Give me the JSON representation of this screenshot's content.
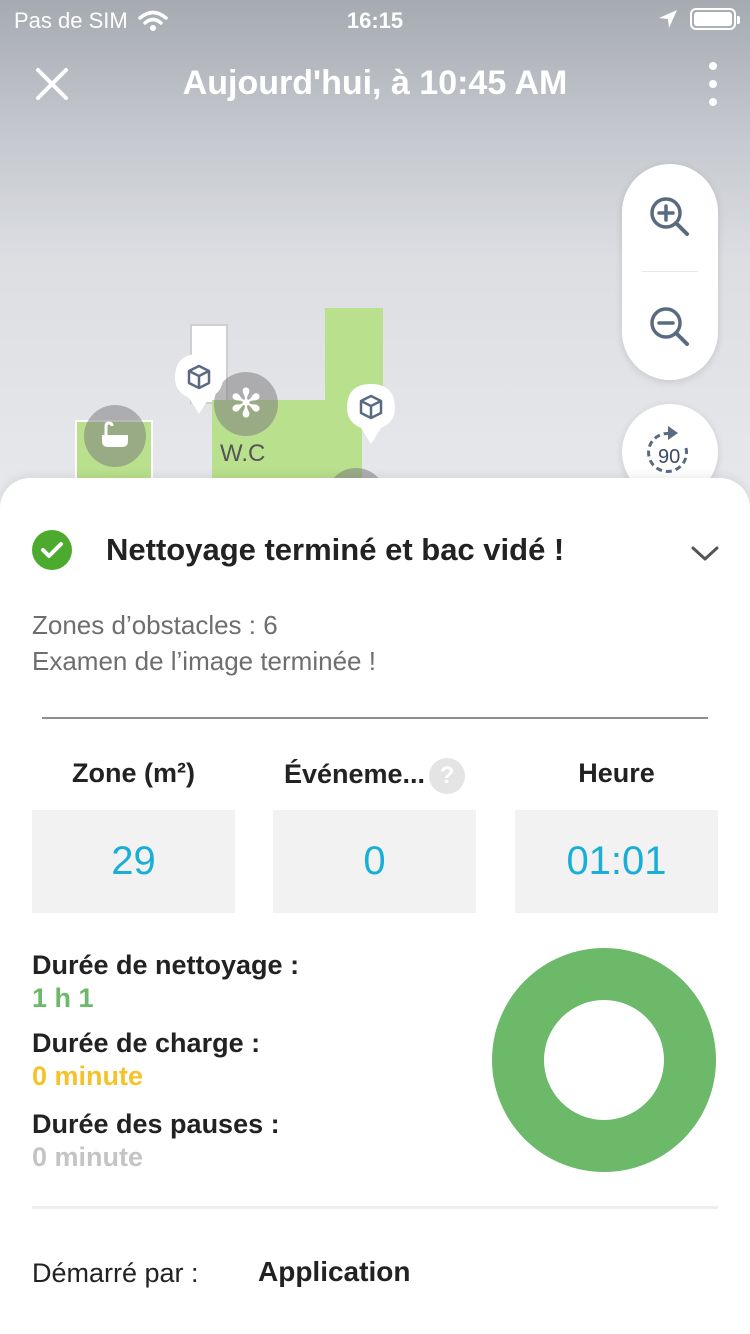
{
  "status_bar": {
    "carrier": "Pas de SIM",
    "time": "16:15"
  },
  "nav": {
    "title": "Aujourd'hui, à 10:45 AM"
  },
  "map": {
    "room_label": "W.C",
    "rotate_label": "90"
  },
  "summary": {
    "status_title": "Nettoyage terminé et bac vidé !",
    "obstacle_zones": "Zones d’obstacles : 6",
    "image_review": "Examen de l’image terminée !"
  },
  "stats": [
    {
      "label": "Zone (m²)",
      "value": "29"
    },
    {
      "label": "Événeme...",
      "value": "0"
    },
    {
      "label": "Heure",
      "value": "01:01"
    }
  ],
  "durations": {
    "cleaning_label": "Durée de nettoyage :",
    "cleaning_value": "1 h 1",
    "charge_label": "Durée de charge :",
    "charge_value": "0 minute",
    "pause_label": "Durée des pauses :",
    "pause_value": "0 minute"
  },
  "started": {
    "label": "Démarré par :",
    "value": "Application"
  },
  "colors": {
    "cleaning": "#6cb96a",
    "charge": "#f4c32a",
    "pause": "#c4c4c4",
    "stat_value": "#19aed6",
    "success": "#4caa2e"
  }
}
